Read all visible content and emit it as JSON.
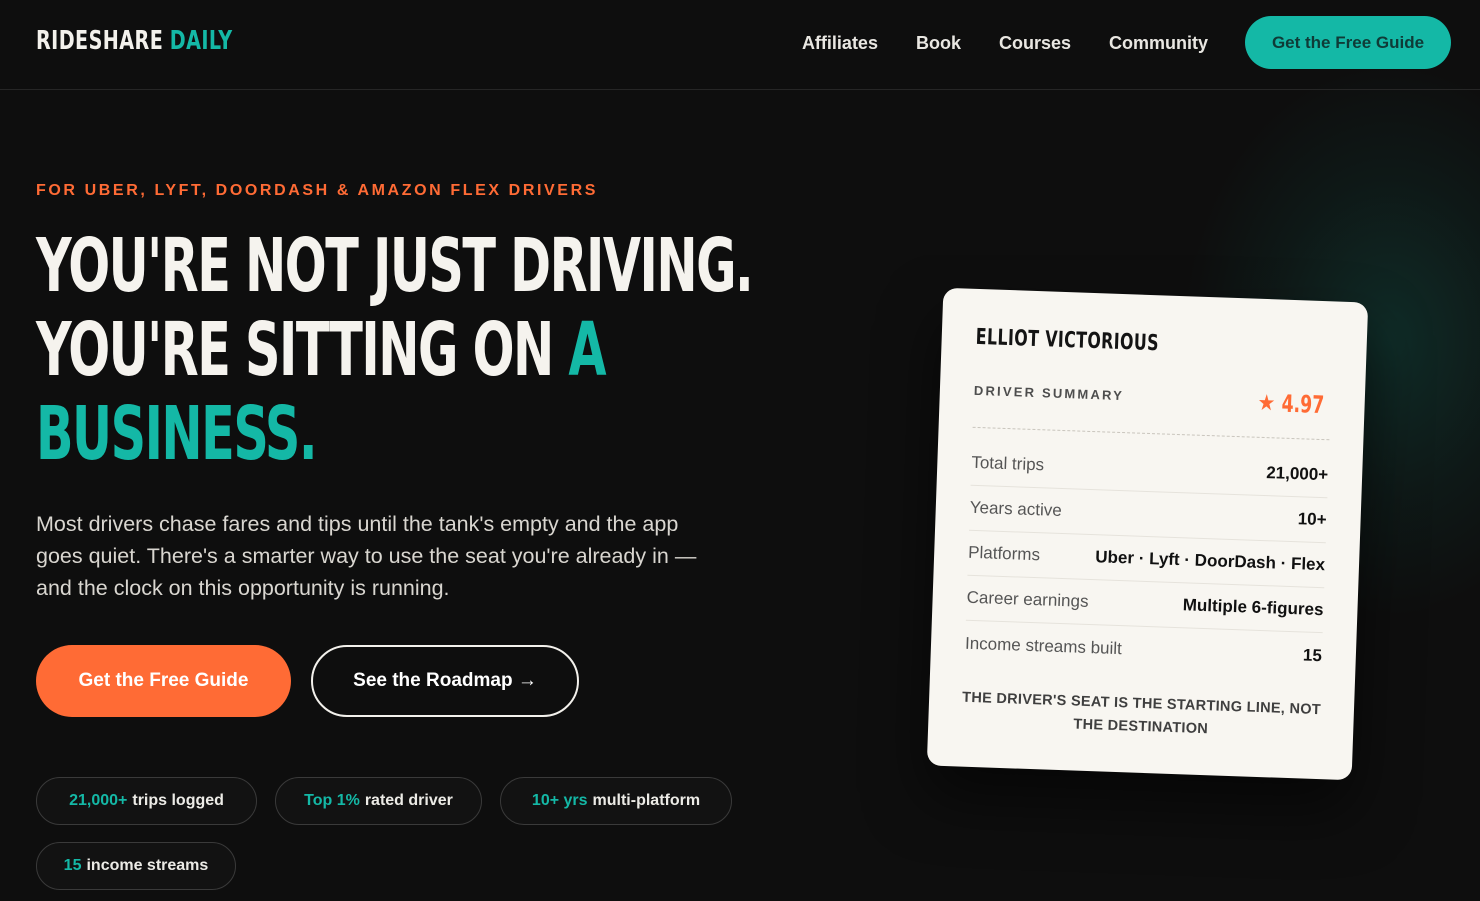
{
  "brand": {
    "part1": "RIDESHARE",
    "part2": "DAILY"
  },
  "nav": {
    "links": [
      "Affiliates",
      "Book",
      "Courses",
      "Community"
    ],
    "cta": "Get the Free Guide"
  },
  "hero": {
    "eyebrow": "FOR UBER, LYFT, DOORDASH & AMAZON FLEX DRIVERS",
    "headline_line1": "YOU'RE NOT JUST DRIVING.",
    "headline_line2": "YOU'RE SITTING ON",
    "headline_accent_a": "A",
    "headline_accent_b": "BUSINESS.",
    "lead": "Most drivers chase fares and tips until the tank's empty and the app goes quiet. There's a smarter way to use the seat you're already in — and the clock on this opportunity is running.",
    "primary_button": "Get the Free Guide",
    "secondary_button": "See the Roadmap →"
  },
  "stats": [
    {
      "highlight": "21,000+",
      "text": "trips logged"
    },
    {
      "highlight": "Top 1%",
      "text": "rated driver"
    },
    {
      "highlight": "10+ yrs",
      "text": "multi-platform"
    },
    {
      "highlight": "15",
      "text": "income streams"
    }
  ],
  "card": {
    "name": "ELLIOT VICTORIOUS",
    "subtitle": "DRIVER SUMMARY",
    "rating": "4.97",
    "rows": [
      {
        "label": "Total trips",
        "value": "21,000+"
      },
      {
        "label": "Years active",
        "value": "10+"
      },
      {
        "label": "Platforms",
        "value": "Uber · Lyft · DoorDash · Flex"
      },
      {
        "label": "Career earnings",
        "value": "Multiple 6-figures"
      },
      {
        "label": "Income streams built",
        "value": "15"
      }
    ],
    "footer": "THE DRIVER'S SEAT IS THE STARTING LINE, NOT THE DESTINATION"
  },
  "colors": {
    "accent_teal": "#14b8a6",
    "accent_orange": "#ff6b35",
    "background": "#0e0e0e"
  },
  "icons": {
    "rating": "star-icon"
  }
}
